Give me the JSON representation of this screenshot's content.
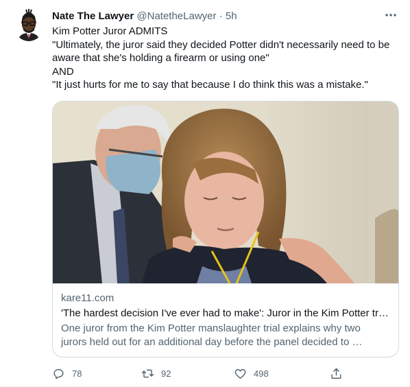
{
  "tweet": {
    "display_name": "Nate The Lawyer",
    "handle": "@NatetheLawyer",
    "separator": "·",
    "time": "5h",
    "lines": [
      "Kim Potter Juror ADMITS",
      "\"Ultimately, the juror said they decided Potter didn't necessarily need to be aware that she's holding a firearm or using one\"",
      "AND",
      "\"It just hurts for me to say that because I do think this was a mistake.\""
    ]
  },
  "card": {
    "domain": "kare11.com",
    "title": "'The hardest decision I've ever had to make': Juror in the Kim Potter trial says",
    "description": "One juror from the Kim Potter manslaughter trial explains why two jurors held out for an additional day before the panel decided to …"
  },
  "actions": {
    "replies": "78",
    "retweets": "92",
    "likes": "498"
  },
  "icons": {
    "more": "more-horizontal-icon",
    "reply": "reply-icon",
    "retweet": "retweet-icon",
    "like": "heart-icon",
    "share": "share-icon"
  },
  "colors": {
    "text": "#0f1419",
    "secondary": "#536471",
    "border": "#cfd9de"
  }
}
